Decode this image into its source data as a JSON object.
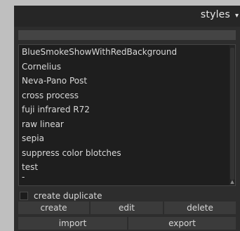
{
  "header": {
    "title": "styles",
    "arrow": "▾"
  },
  "entry": {
    "value": ""
  },
  "styles_list": {
    "items": [
      "BlueSmokeShowWithRedBackground",
      "Cornelius",
      "Neva-Pano Post",
      "cross process",
      "fuji infrared R72",
      "raw linear",
      "sepia",
      "suppress color blotches",
      "test",
      "-"
    ],
    "scroll_down_icon": "▲"
  },
  "options": {
    "create_duplicate_label": "create duplicate"
  },
  "buttons": {
    "create": "create",
    "edit": "edit",
    "delete": "delete",
    "import": "import",
    "export": "export"
  }
}
